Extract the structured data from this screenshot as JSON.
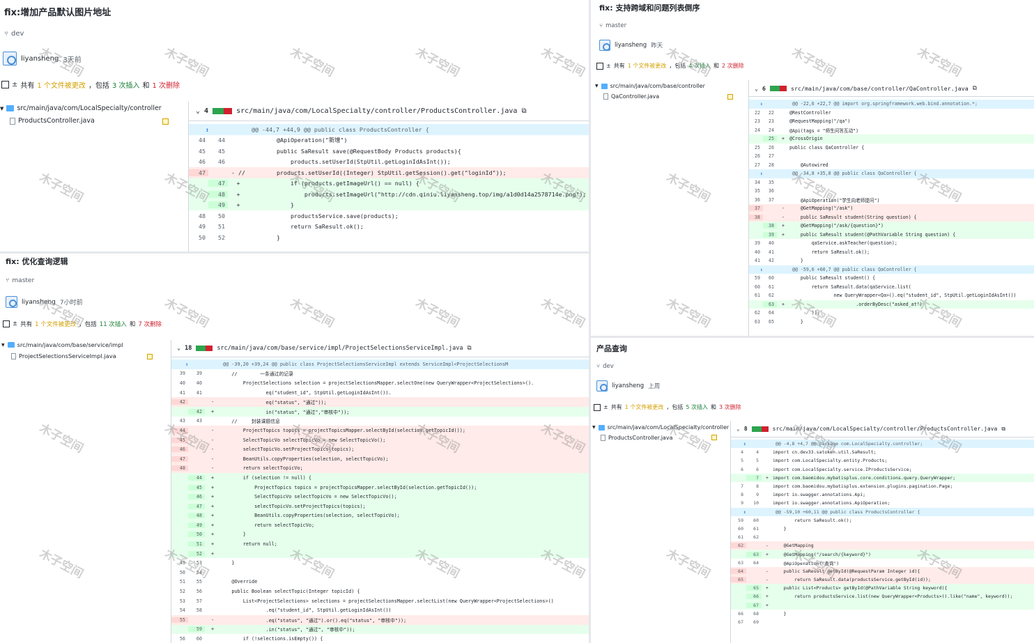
{
  "watermark": "木子空间",
  "panels": {
    "p1": {
      "title": "fix:增加产品默认图片地址",
      "branch": "dev",
      "author": "liyansheng",
      "time": "3天前",
      "stats": {
        "prefix": "共有",
        "files": "1 个文件被更改",
        "mid": "，包括",
        "ins": "3 次插入",
        "and": "和",
        "del": "1 次删除"
      },
      "tree": {
        "folder": "src/main/java/com/LocalSpecialty/controller",
        "file": "ProductsController.java"
      },
      "diff": {
        "count": "4",
        "path": "src/main/java/com/LocalSpecialty/controller/ProductsController.java",
        "lines": [
          {
            "t": "hunk",
            "a": "",
            "b": "",
            "s": "",
            "c": "@@ -44,7 +44,9 @@ public class ProductsController {"
          },
          {
            "t": "ctx",
            "a": "44",
            "b": "44",
            "s": "",
            "c": "        @ApiOperation(\"新增\")"
          },
          {
            "t": "ctx",
            "a": "45",
            "b": "45",
            "s": "",
            "c": "        public SaResult save(@RequestBody Products products){"
          },
          {
            "t": "ctx",
            "a": "46",
            "b": "46",
            "s": "",
            "c": "            products.setUserId(StpUtil.getLoginIdAsInt());"
          },
          {
            "t": "del",
            "a": "47",
            "b": "",
            "s": "- //",
            "c": "        products.setUserId((Integer) StpUtil.getSession().get(\"loginId\"));"
          },
          {
            "t": "add",
            "a": "",
            "b": "47",
            "s": "+",
            "c": "            if (products.getImageUrl() == null) {"
          },
          {
            "t": "add",
            "a": "",
            "b": "48",
            "s": "+",
            "c": "                products.setImageUrl(\"http://cdn.qiniu.liyansheng.top/img/a1d0d14a2578714e.png\");"
          },
          {
            "t": "add",
            "a": "",
            "b": "49",
            "s": "+",
            "c": "            }"
          },
          {
            "t": "ctx",
            "a": "48",
            "b": "50",
            "s": "",
            "c": "            productsService.save(products);"
          },
          {
            "t": "ctx",
            "a": "49",
            "b": "51",
            "s": "",
            "c": "            return SaResult.ok();"
          },
          {
            "t": "ctx",
            "a": "50",
            "b": "52",
            "s": "",
            "c": "        }"
          }
        ]
      }
    },
    "p2": {
      "title": "fix: 支持跨域和问题列表倒序",
      "branch": "master",
      "author": "liyansheng",
      "time": "昨天",
      "stats": {
        "prefix": "共有",
        "files": "1 个文件被更改",
        "mid": "，包括",
        "ins": "4 次插入",
        "and": "和",
        "del": "2 次删除"
      },
      "tree": {
        "folder": "src/main/java/com/base/controller",
        "file": "QaController.java"
      },
      "diff": {
        "count": "6",
        "path": "src/main/java/com/base/controller/QaController.java",
        "lines": [
          {
            "t": "hunk",
            "a": "",
            "b": "",
            "s": "",
            "c": "@@ -22,6 +22,7 @@ import org.springframework.web.bind.annotation.*;"
          },
          {
            "t": "ctx",
            "a": "22",
            "b": "22",
            "s": "",
            "c": "@RestController"
          },
          {
            "t": "ctx",
            "a": "23",
            "b": "23",
            "s": "",
            "c": "@RequestMapping(\"/qa\")"
          },
          {
            "t": "ctx",
            "a": "24",
            "b": "24",
            "s": "",
            "c": "@Api(tags = \"师生问答互动\")"
          },
          {
            "t": "add",
            "a": "",
            "b": "25",
            "s": "+",
            "c": "@CrossOrigin"
          },
          {
            "t": "ctx",
            "a": "25",
            "b": "26",
            "s": "",
            "c": "public class QaController {"
          },
          {
            "t": "ctx",
            "a": "26",
            "b": "27",
            "s": "",
            "c": ""
          },
          {
            "t": "ctx",
            "a": "27",
            "b": "28",
            "s": "",
            "c": "    @Autowired"
          },
          {
            "t": "hunk",
            "a": "",
            "b": "",
            "s": "",
            "c": "@@ -34,8 +35,8 @@ public class QaController {"
          },
          {
            "t": "ctx",
            "a": "34",
            "b": "35",
            "s": "",
            "c": ""
          },
          {
            "t": "ctx",
            "a": "35",
            "b": "36",
            "s": "",
            "c": ""
          },
          {
            "t": "ctx",
            "a": "36",
            "b": "37",
            "s": "",
            "c": "    @ApiOperation(\"学生向老师提问\")"
          },
          {
            "t": "del",
            "a": "37",
            "b": "",
            "s": "-",
            "c": "    @GetMapping(\"/ask\")"
          },
          {
            "t": "del",
            "a": "38",
            "b": "",
            "s": "-",
            "c": "    public SaResult student(String question) {"
          },
          {
            "t": "add",
            "a": "",
            "b": "38",
            "s": "+",
            "c": "    @GetMapping(\"/ask/{question}\")"
          },
          {
            "t": "add",
            "a": "",
            "b": "39",
            "s": "+",
            "c": "    public SaResult student(@PathVariable String question) {"
          },
          {
            "t": "ctx",
            "a": "39",
            "b": "40",
            "s": "",
            "c": "        qaService.askTeacher(question);"
          },
          {
            "t": "ctx",
            "a": "40",
            "b": "41",
            "s": "",
            "c": "        return SaResult.ok();"
          },
          {
            "t": "ctx",
            "a": "41",
            "b": "42",
            "s": "",
            "c": "    }"
          },
          {
            "t": "hunk",
            "a": "",
            "b": "",
            "s": "",
            "c": "@@ -59,6 +60,7 @@ public class QaController {"
          },
          {
            "t": "ctx",
            "a": "59",
            "b": "60",
            "s": "",
            "c": "    public SaResult student() {"
          },
          {
            "t": "ctx",
            "a": "60",
            "b": "61",
            "s": "",
            "c": "        return SaResult.data(qaService.list("
          },
          {
            "t": "ctx",
            "a": "61",
            "b": "62",
            "s": "",
            "c": "                new QueryWrapper<Qa>().eq(\"student_id\", StpUtil.getLoginIdAsInt())"
          },
          {
            "t": "add",
            "a": "",
            "b": "63",
            "s": "+",
            "c": "                        .orderByDesc(\"asked_at\")"
          },
          {
            "t": "ctx",
            "a": "62",
            "b": "64",
            "s": "",
            "c": "        ));"
          },
          {
            "t": "ctx",
            "a": "63",
            "b": "65",
            "s": "",
            "c": "    }"
          }
        ]
      }
    },
    "p3": {
      "title": "fix: 优化查询逻辑",
      "branch": "master",
      "author": "liyansheng",
      "time": "7小时前",
      "stats": {
        "prefix": "共有",
        "files": "1 个文件被更改",
        "mid": "，包括",
        "ins": "11 次插入",
        "and": "和",
        "del": "7 次删除"
      },
      "tree": {
        "folder": "src/main/java/com/base/service/impl",
        "file": "ProjectSelectionsServiceImpl.java"
      },
      "diff": {
        "count": "18",
        "path": "src/main/java/com/base/service/impl/ProjectSelectionsServiceImpl.java",
        "lines": [
          {
            "t": "hunk",
            "a": "",
            "b": "",
            "s": "",
            "c": "@@ -39,20 +39,24 @@ public class ProjectSelectionsServiceImpl extends ServiceImpl<ProjectSelectionsM"
          },
          {
            "t": "ctx",
            "a": "39",
            "b": "39",
            "s": "",
            "c": "    //        一条通过的记录"
          },
          {
            "t": "ctx",
            "a": "40",
            "b": "40",
            "s": "",
            "c": "        ProjectSelections selection = projectSelectionsMapper.selectOne(new QueryWrapper<ProjectSelections>()."
          },
          {
            "t": "ctx",
            "a": "41",
            "b": "41",
            "s": "",
            "c": "                eq(\"student_id\", StpUtil.getLoginIdAsInt())."
          },
          {
            "t": "del",
            "a": "42",
            "b": "",
            "s": "-",
            "c": "                eq(\"status\", \"通过\"));"
          },
          {
            "t": "add",
            "a": "",
            "b": "42",
            "s": "+",
            "c": "                in(\"status\", \"通过\",\"审核中\"));"
          },
          {
            "t": "ctx",
            "a": "43",
            "b": "43",
            "s": "",
            "c": "    //     封装课题信息"
          },
          {
            "t": "del",
            "a": "44",
            "b": "",
            "s": "-",
            "c": "        ProjectTopics topics = projectTopicsMapper.selectById(selection.getTopicId());"
          },
          {
            "t": "del",
            "a": "45",
            "b": "",
            "s": "-",
            "c": "        SelectTopicVo selectTopicVo = new SelectTopicVo();"
          },
          {
            "t": "del",
            "a": "46",
            "b": "",
            "s": "-",
            "c": "        selectTopicVo.setProjectTopics(topics);"
          },
          {
            "t": "del",
            "a": "47",
            "b": "",
            "s": "-",
            "c": "        BeanUtils.copyProperties(selection, selectTopicVo);"
          },
          {
            "t": "del",
            "a": "48",
            "b": "",
            "s": "-",
            "c": "        return selectTopicVo;"
          },
          {
            "t": "add",
            "a": "",
            "b": "44",
            "s": "+",
            "c": "        if (selection != null) {"
          },
          {
            "t": "add",
            "a": "",
            "b": "45",
            "s": "+",
            "c": "            ProjectTopics topics = projectTopicsMapper.selectById(selection.getTopicId());"
          },
          {
            "t": "add",
            "a": "",
            "b": "46",
            "s": "+",
            "c": "            SelectTopicVo selectTopicVo = new SelectTopicVo();"
          },
          {
            "t": "add",
            "a": "",
            "b": "47",
            "s": "+",
            "c": "            selectTopicVo.setProjectTopics(topics);"
          },
          {
            "t": "add",
            "a": "",
            "b": "48",
            "s": "+",
            "c": "            BeanUtils.copyProperties(selection, selectTopicVo);"
          },
          {
            "t": "add",
            "a": "",
            "b": "49",
            "s": "+",
            "c": "            return selectTopicVo;"
          },
          {
            "t": "add",
            "a": "",
            "b": "50",
            "s": "+",
            "c": "        }"
          },
          {
            "t": "add",
            "a": "",
            "b": "51",
            "s": "+",
            "c": "        return null;"
          },
          {
            "t": "add",
            "a": "",
            "b": "52",
            "s": "+",
            "c": ""
          },
          {
            "t": "ctx",
            "a": "49",
            "b": "53",
            "s": "",
            "c": "    }"
          },
          {
            "t": "ctx",
            "a": "50",
            "b": "54",
            "s": "",
            "c": ""
          },
          {
            "t": "ctx",
            "a": "51",
            "b": "55",
            "s": "",
            "c": "    @Override"
          },
          {
            "t": "ctx",
            "a": "52",
            "b": "56",
            "s": "",
            "c": "    public Boolean selectTopic(Integer topicId) {"
          },
          {
            "t": "ctx",
            "a": "53",
            "b": "57",
            "s": "",
            "c": "        List<ProjectSelections> selections = projectSelectionsMapper.selectList(new QueryWrapper<ProjectSelections>()"
          },
          {
            "t": "ctx",
            "a": "54",
            "b": "58",
            "s": "",
            "c": "                .eq(\"student_id\", StpUtil.getLoginIdAsInt())"
          },
          {
            "t": "del",
            "a": "55",
            "b": "",
            "s": "-",
            "c": "                .eq(\"status\", \"通过\").or().eq(\"status\", \"审核中\"));"
          },
          {
            "t": "add",
            "a": "",
            "b": "59",
            "s": "+",
            "c": "                .in(\"status\", \"通过\", \"审核中\"));"
          },
          {
            "t": "ctx",
            "a": "56",
            "b": "60",
            "s": "",
            "c": "        if (!selections.isEmpty()) {"
          }
        ]
      }
    },
    "p4": {
      "title": "产品查询",
      "branch": "dev",
      "author": "liyansheng",
      "time": "上周",
      "stats": {
        "prefix": "共有",
        "files": "1 个文件被更改",
        "mid": "，包括",
        "ins": "5 次插入",
        "and": "和",
        "del": "3 次删除"
      },
      "tree": {
        "folder": "src/main/java/com/LocalSpecialty/controller",
        "file": "ProductsController.java"
      },
      "diff": {
        "count": "8",
        "path": "src/main/java/com/LocalSpecialty/controller/ProductsController.java",
        "lines": [
          {
            "t": "hunk",
            "a": "",
            "b": "",
            "s": "",
            "c": "@@ -4,8 +4,7 @@ package com.LocalSpecialty.controller;"
          },
          {
            "t": "ctx",
            "a": "4",
            "b": "4",
            "s": "",
            "c": "import cn.dev33.satoken.util.SaResult;"
          },
          {
            "t": "ctx",
            "a": "5",
            "b": "5",
            "s": "",
            "c": "import com.LocalSpecialty.entity.Products;"
          },
          {
            "t": "ctx",
            "a": "6",
            "b": "6",
            "s": "",
            "c": "import com.LocalSpecialty.service.IProductsService;"
          },
          {
            "t": "add",
            "a": "",
            "b": "7",
            "s": "+",
            "c": "import com.baomidou.mybatisplus.core.conditions.query.QueryWrapper;"
          },
          {
            "t": "ctx",
            "a": "7",
            "b": "8",
            "s": "",
            "c": "import com.baomidou.mybatisplus.extension.plugins.pagination.Page;"
          },
          {
            "t": "ctx",
            "a": "8",
            "b": "9",
            "s": "",
            "c": "import io.swagger.annotations.Api;"
          },
          {
            "t": "ctx",
            "a": "9",
            "b": "10",
            "s": "",
            "c": "import io.swagger.annotations.ApiOperation;"
          },
          {
            "t": "hunk",
            "a": "",
            "b": "",
            "s": "",
            "c": "@@ -59,10 +60,11 @@ public class ProductsController {"
          },
          {
            "t": "ctx",
            "a": "59",
            "b": "60",
            "s": "",
            "c": "        return SaResult.ok();"
          },
          {
            "t": "ctx",
            "a": "60",
            "b": "61",
            "s": "",
            "c": "    }"
          },
          {
            "t": "ctx",
            "a": "61",
            "b": "62",
            "s": "",
            "c": ""
          },
          {
            "t": "del",
            "a": "62",
            "b": "",
            "s": "-",
            "c": "    @GetMapping"
          },
          {
            "t": "add",
            "a": "",
            "b": "63",
            "s": "+",
            "c": "    @GetMapping(\"/search/{keyword}\")"
          },
          {
            "t": "ctx",
            "a": "63",
            "b": "64",
            "s": "",
            "c": "    @ApiOperation(\"查询\")"
          },
          {
            "t": "del",
            "a": "64",
            "b": "",
            "s": "-",
            "c": "    public SaResult getById(@RequestParam Integer id){"
          },
          {
            "t": "del",
            "a": "65",
            "b": "",
            "s": "-",
            "c": "        return SaResult.data(productsService.getById(id));"
          },
          {
            "t": "add",
            "a": "",
            "b": "65",
            "s": "+",
            "c": "    public List<Products> getById(@PathVariable String keyword){"
          },
          {
            "t": "add",
            "a": "",
            "b": "66",
            "s": "+",
            "c": "        return productsService.list(new QueryWrapper<Products>().like(\"name\", keyword));"
          },
          {
            "t": "add",
            "a": "",
            "b": "67",
            "s": "+",
            "c": ""
          },
          {
            "t": "ctx",
            "a": "66",
            "b": "68",
            "s": "",
            "c": "    }"
          },
          {
            "t": "ctx",
            "a": "67",
            "b": "69",
            "s": "",
            "c": ""
          }
        ]
      }
    }
  }
}
